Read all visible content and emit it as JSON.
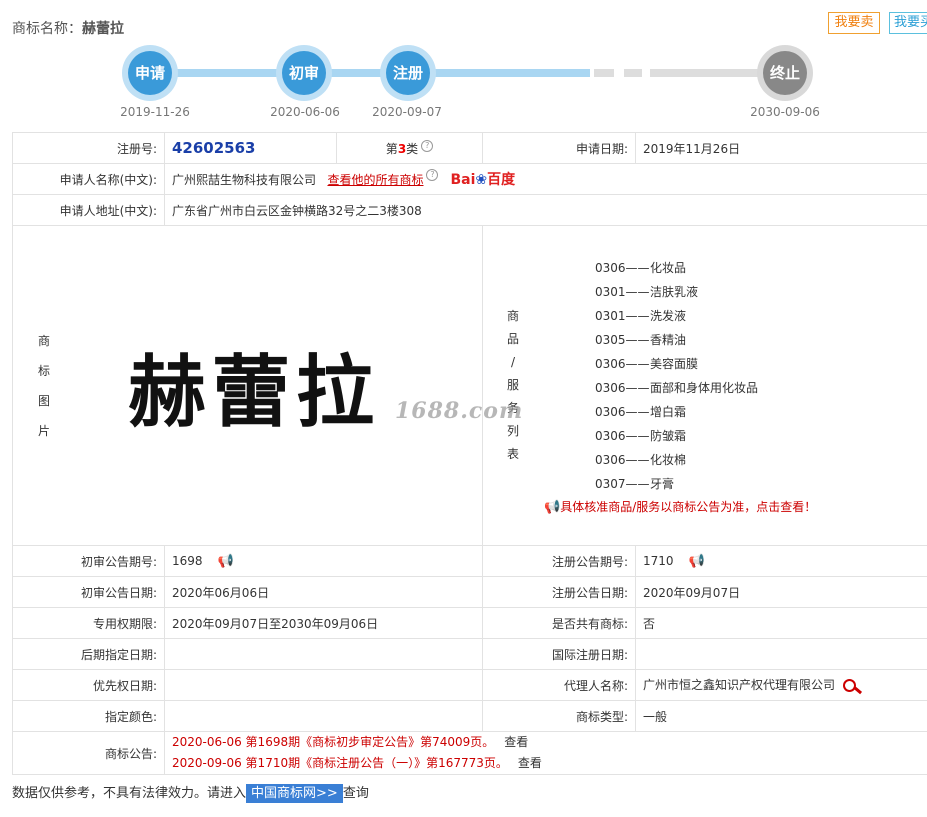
{
  "header": {
    "title_label": "商标名称：",
    "title_value": "赫蕾拉",
    "sell_button": "我要卖",
    "buy_button": "我要买"
  },
  "timeline": {
    "steps": [
      {
        "label": "申请",
        "date": "2019-11-26"
      },
      {
        "label": "初审",
        "date": "2020-06-06"
      },
      {
        "label": "注册",
        "date": "2020-09-07"
      },
      {
        "label": "终止",
        "date": "2030-09-06"
      }
    ]
  },
  "info": {
    "reg_no_label": "注册号:",
    "reg_no": "42602563",
    "class_prefix": "第",
    "class_num": "3",
    "class_suffix": "类",
    "apply_date_label": "申请日期:",
    "apply_date": "2019年11月26日",
    "applicant_label": "申请人名称(中文):",
    "applicant": "广州熙喆生物科技有限公司",
    "view_all_link": "查看他的所有商标",
    "baidu_a": "Bai",
    "baidu_b": "百度",
    "address_label": "申请人地址(中文):",
    "address": "广东省广州市白云区金钟横路32号之二3楼308",
    "mark_image_label": [
      "商",
      "标",
      "图",
      "片"
    ],
    "mark_image_text": "赫蕾拉",
    "watermark": "1688.com",
    "goods_label": [
      "商",
      "品",
      "/",
      "服",
      "务",
      "列",
      "表"
    ],
    "goods": [
      {
        "code": "0306——",
        "name": "化妆品"
      },
      {
        "code": "0301——",
        "name": "洁肤乳液"
      },
      {
        "code": "0301——",
        "name": "洗发液"
      },
      {
        "code": "0305——",
        "name": "香精油"
      },
      {
        "code": "0306——",
        "name": "美容面膜"
      },
      {
        "code": "0306——",
        "name": "面部和身体用化妆品"
      },
      {
        "code": "0306——",
        "name": "增白霜"
      },
      {
        "code": "0306——",
        "name": "防皱霜"
      },
      {
        "code": "0306——",
        "name": "化妆棉"
      },
      {
        "code": "0307——",
        "name": "牙膏"
      }
    ],
    "goods_note": "具体核准商品/服务以商标公告为准，点击查看！",
    "prelim_no_label": "初审公告期号:",
    "prelim_no": "1698",
    "reg_pub_no_label": "注册公告期号:",
    "reg_pub_no": "1710",
    "prelim_date_label": "初审公告日期:",
    "prelim_date": "2020年06月06日",
    "reg_pub_date_label": "注册公告日期:",
    "reg_pub_date": "2020年09月07日",
    "excl_label": "专用权期限:",
    "excl_period": "2020年09月07日至2030年09月06日",
    "shared_label": "是否共有商标:",
    "shared": "否",
    "later_label": "后期指定日期:",
    "later": "",
    "intl_label": "国际注册日期:",
    "intl": "",
    "priority_label": "优先权日期:",
    "priority": "",
    "agent_label": "代理人名称:",
    "agent": "广州市恒之鑫知识产权代理有限公司",
    "color_label": "指定颜色:",
    "color": "",
    "type_label": "商标类型:",
    "type": "一般",
    "notice_label": "商标公告:",
    "notices": [
      {
        "text": "2020-06-06 第1698期《商标初步审定公告》第74009页。",
        "view": "查看"
      },
      {
        "text": "2020-09-06 第1710期《商标注册公告（一）》第167773页。",
        "view": "查看"
      }
    ]
  },
  "footer": {
    "prefix": "数据仅供参考，不具有法律效力。请进入",
    "link": "中国商标网>>",
    "suffix": "查询"
  }
}
